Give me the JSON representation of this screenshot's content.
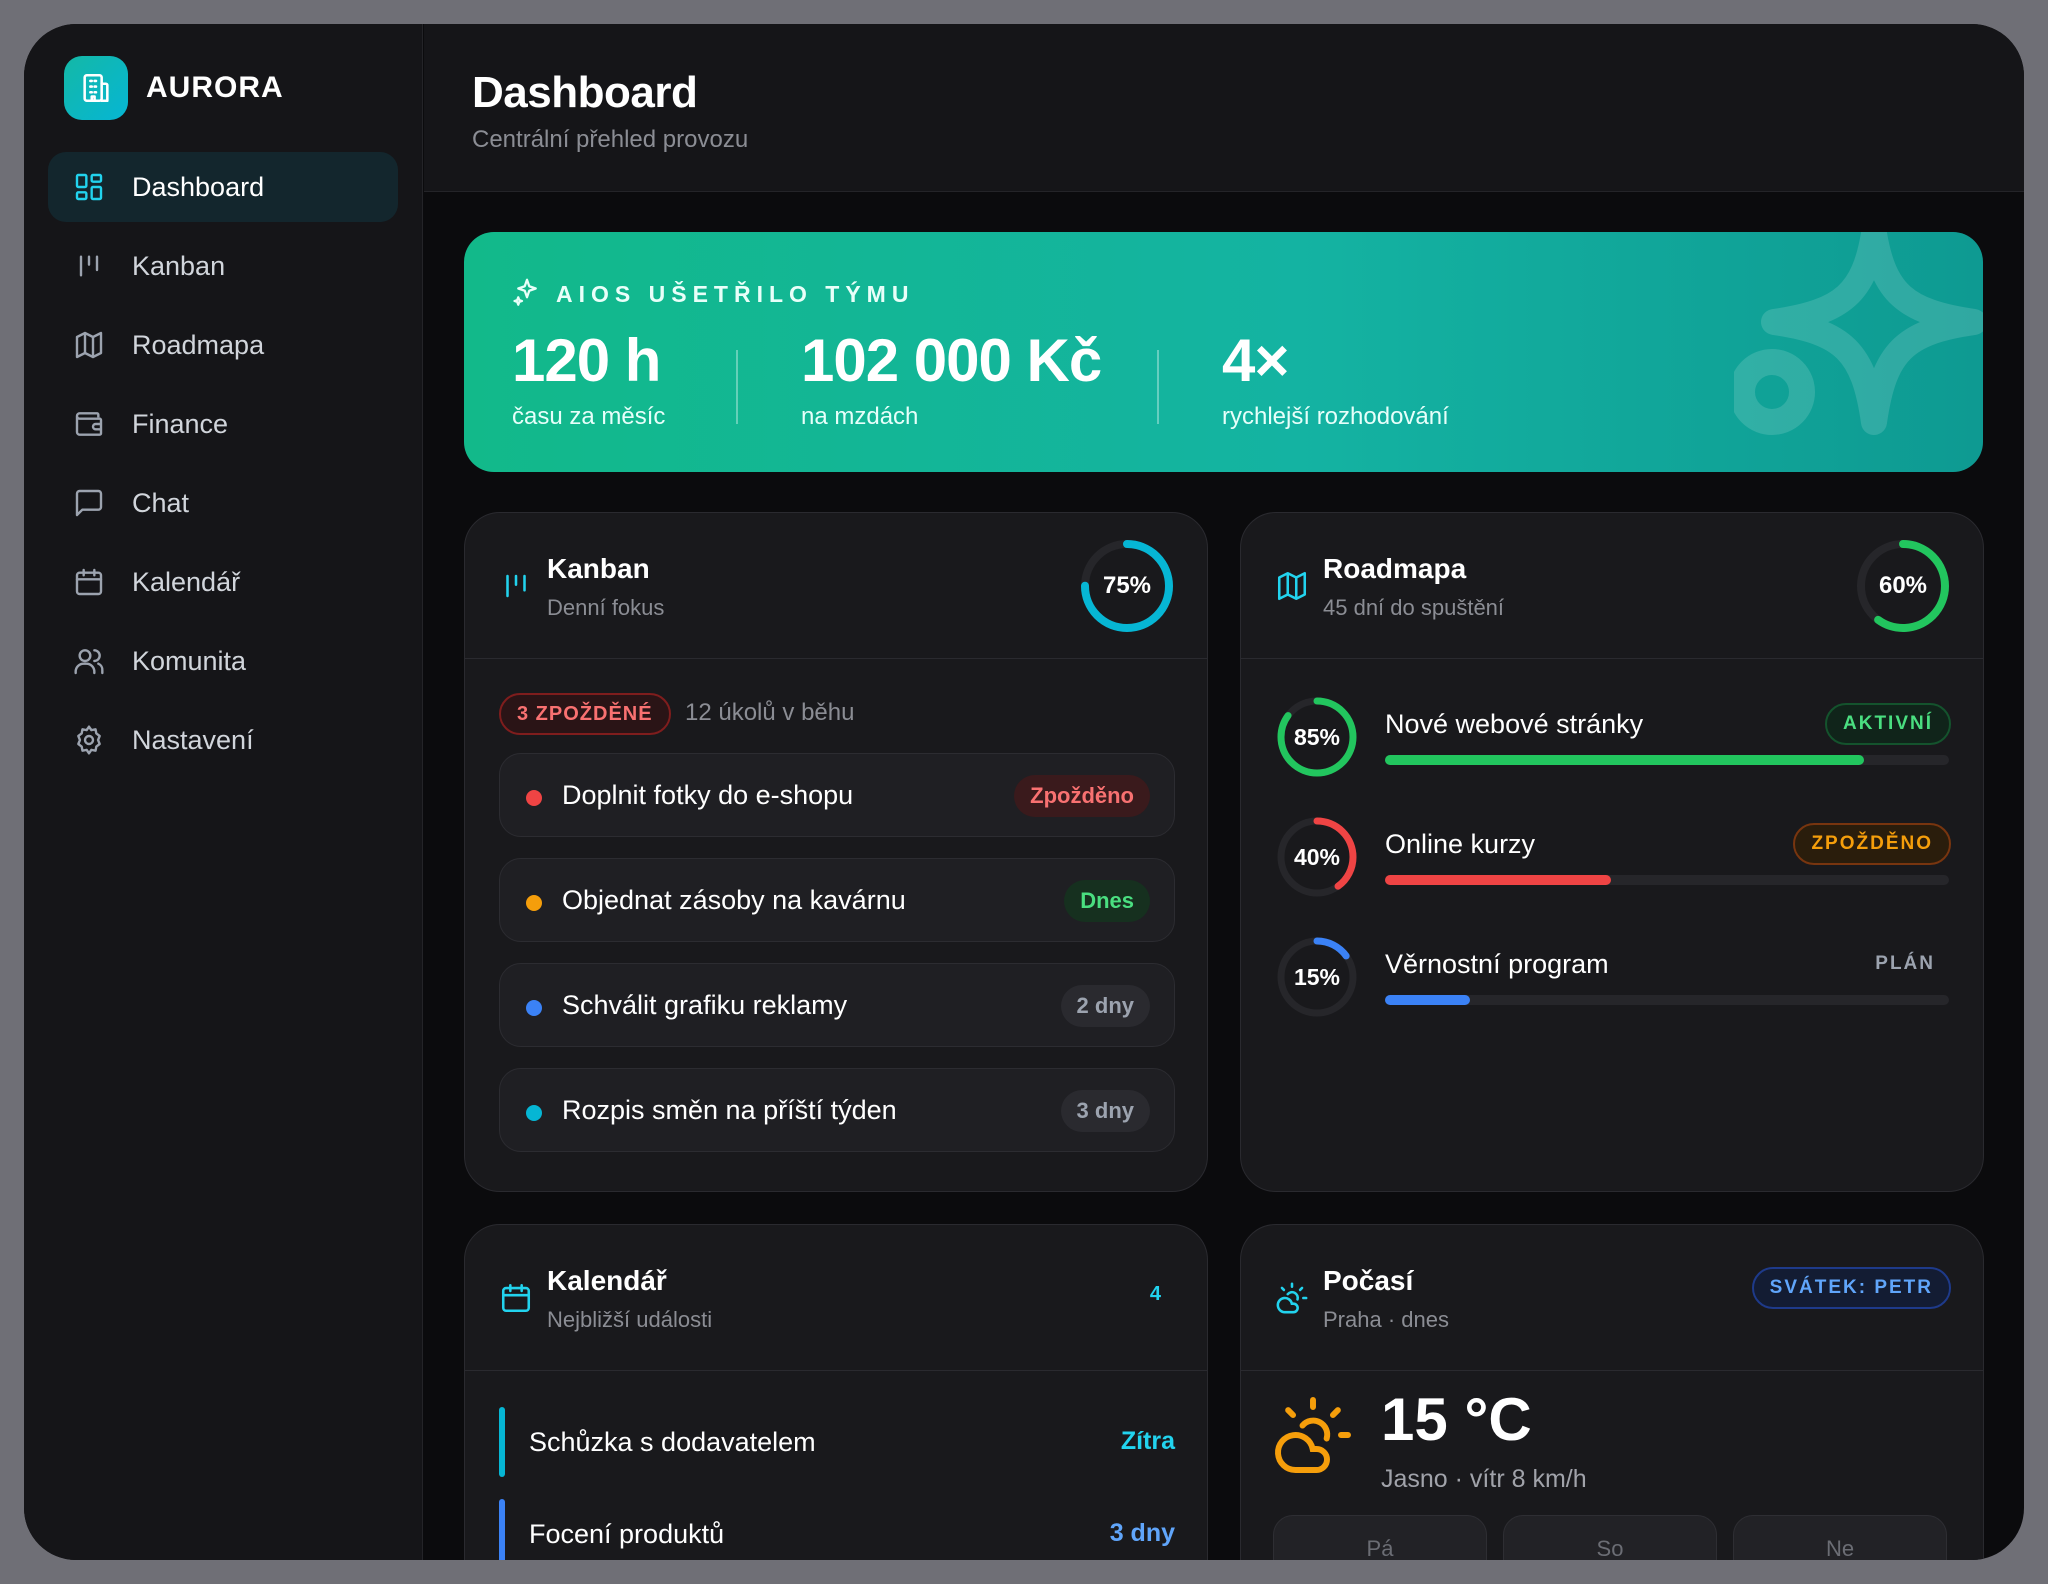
{
  "brand": {
    "name": "AURORA"
  },
  "sidebar": {
    "items": [
      {
        "label": "Dashboard",
        "icon": "dashboard-icon",
        "active": true
      },
      {
        "label": "Kanban",
        "icon": "kanban-icon"
      },
      {
        "label": "Roadmapa",
        "icon": "map-icon"
      },
      {
        "label": "Finance",
        "icon": "wallet-icon"
      },
      {
        "label": "Chat",
        "icon": "chat-icon"
      },
      {
        "label": "Kalendář",
        "icon": "calendar-icon"
      },
      {
        "label": "Komunita",
        "icon": "users-icon"
      },
      {
        "label": "Nastavení",
        "icon": "gear-icon"
      }
    ]
  },
  "header": {
    "title": "Dashboard",
    "subtitle": "Centrální přehled provozu"
  },
  "hero": {
    "heading": "AIOS UŠETŘILO TÝMU",
    "stats": [
      {
        "value": "120 h",
        "label": "času za měsíc"
      },
      {
        "value": "102 000 Kč",
        "label": "na mzdách"
      },
      {
        "value": "4×",
        "label": "rychlejší rozhodování"
      }
    ],
    "colors": {
      "start": "#12b98a",
      "end": "#0e9a92"
    }
  },
  "kanban": {
    "title": "Kanban",
    "subtitle": "Denní fokus",
    "progress": 75,
    "progress_label": "75%",
    "delayed_badge": "3 ZPOŽDĚNÉ",
    "count_text": "12 úkolů v běhu",
    "tasks": [
      {
        "name": "Doplnit fotky do e-shopu",
        "badge": "Zpožděno",
        "dot": "#ef4444"
      },
      {
        "name": "Objednat zásoby na kavárnu",
        "badge": "Dnes",
        "dot": "#f59e0b"
      },
      {
        "name": "Schválit grafiku reklamy",
        "badge": "2 dny",
        "dot": "#3b82f6"
      },
      {
        "name": "Rozpis směn na příští týden",
        "badge": "3 dny",
        "dot": "#06b6d4"
      }
    ]
  },
  "roadmap": {
    "title": "Roadmapa",
    "subtitle": "45 dní do spuštění",
    "progress": 60,
    "progress_label": "60%",
    "projects": [
      {
        "name": "Nové webové stránky",
        "percent": 85,
        "percent_label": "85%",
        "status": "AKTIVNÍ",
        "color": "#22c55e"
      },
      {
        "name": "Online kurzy",
        "percent": 40,
        "percent_label": "40%",
        "status": "ZPOŽDĚNO",
        "color": "#ef4444"
      },
      {
        "name": "Věrnostní program",
        "percent": 15,
        "percent_label": "15%",
        "status": "PLÁN",
        "color": "#3b82f6"
      }
    ]
  },
  "calendar": {
    "title": "Kalendář",
    "subtitle": "Nejbližší události",
    "count": "4",
    "events": [
      {
        "name": "Schůzka s dodavatelem",
        "when": "Zítra",
        "color": "#06b6d4"
      },
      {
        "name": "Focení produktů",
        "when": "3 dny",
        "color": "#3b82f6"
      }
    ]
  },
  "weather": {
    "title": "Počasí",
    "subtitle": "Praha · dnes",
    "holiday": "SVÁTEK: PETR",
    "temperature": "15 °C",
    "description": "Jasno · vítr 8 km/h",
    "days": [
      "Pá",
      "So",
      "Ne"
    ]
  }
}
